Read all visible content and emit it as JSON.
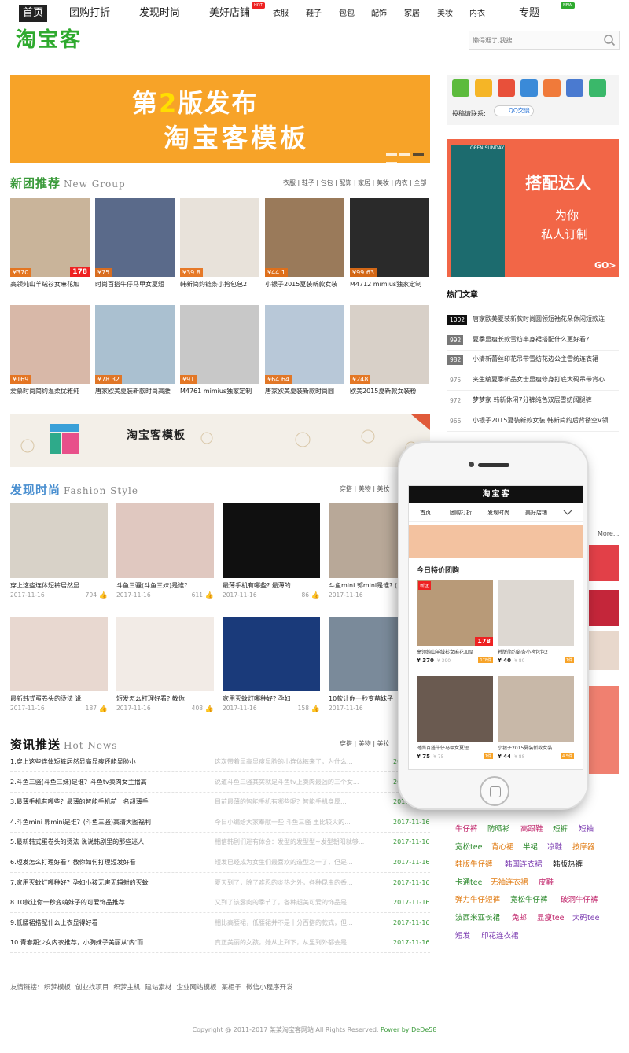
{
  "nav": {
    "main": [
      "首页",
      "团购打折",
      "发现时尚",
      "美好店铺"
    ],
    "categories": [
      "衣服",
      "鞋子",
      "包包",
      "配饰",
      "家居",
      "美妆",
      "内衣"
    ],
    "special": "专题",
    "badges": {
      "hot": "HOT",
      "new": "NEW"
    }
  },
  "logo": "淘宝客",
  "search": {
    "placeholder": "懒得逛了,我搜..."
  },
  "banner": {
    "prefix": "第",
    "version": "2",
    "suffix": "版发布",
    "line2": "淘宝客模板"
  },
  "new_group": {
    "title": "新团推荐",
    "title_en": "New Group",
    "links": "衣服 | 鞋子 | 包包 | 配饰 | 家居 | 美妆 | 内衣 | 全部",
    "products": [
      {
        "price": "¥370",
        "caption": "高领纯山羊绒衫女麻花加",
        "badge": "178"
      },
      {
        "price": "¥75",
        "caption": "时尚百搭牛仔马甲女夏短"
      },
      {
        "price": "¥39.8",
        "caption": "韩新简约链条小挎包包2"
      },
      {
        "price": "¥44.1",
        "caption": "小银子2015夏装新款女装"
      },
      {
        "price": "¥99.63",
        "caption": "M4712 mimius独家定制"
      },
      {
        "price": "¥169",
        "caption": "爱慕时尚简约温柔优雅纯"
      },
      {
        "price": "¥78.32",
        "caption": "唐家欧美夏装新款时尚高腰"
      },
      {
        "price": "¥91",
        "caption": "M4761 mimius独家定制"
      },
      {
        "price": "¥64.64",
        "caption": "唐家欧美夏装新款时尚圆"
      },
      {
        "price": "¥248",
        "caption": "欧美2015夏新款女装粉"
      }
    ]
  },
  "mid_banner": {
    "text": "淘宝客模板"
  },
  "fashion": {
    "title": "发现时尚",
    "title_en": "Fashion Style",
    "links": "穿搭 | 美物 | 美妆",
    "items": [
      {
        "caption": "穿上这些连体短裤居然显",
        "date": "2017-11-16",
        "count": "794"
      },
      {
        "caption": "斗鱼三骚(斗鱼三妹)是谁?",
        "date": "2017-11-16",
        "count": "611"
      },
      {
        "caption": "最薄手机有哪些? 最薄的",
        "date": "2017-11-16",
        "count": "86"
      },
      {
        "caption": "斗鱼mini 郭mini是谁? (",
        "date": "2017-11-16",
        "count": ""
      },
      {
        "caption": "最新韩式蛋卷头的烫法 说",
        "date": "2017-11-16",
        "count": "187"
      },
      {
        "caption": "短发怎么打理好看? 教你",
        "date": "2017-11-16",
        "count": "408"
      },
      {
        "caption": "家用灭蚊灯哪种好? 孕妇",
        "date": "2017-11-16",
        "count": "158"
      },
      {
        "caption": "10款让你一秒变萌妹子",
        "date": "2017-11-16",
        "count": ""
      }
    ]
  },
  "news": {
    "title": "资讯推送",
    "title_en": "Hot News",
    "links": "穿搭 | 美物 | 美妆",
    "items": [
      {
        "title": "1.穿上这些连体短裤居然显高显瘦还能显脸小",
        "desc": "这次带着显高显瘦显脸的小连体裤来了，为什么...",
        "date": "2017-11-16"
      },
      {
        "title": "2.斗鱼三骚(斗鱼三妹)是谁？斗鱼tv卖肉女主播高",
        "desc": "说道斗鱼三骚其实就是斗鱼tv上卖肉最凶的三个女...",
        "date": "2017-11-16"
      },
      {
        "title": "3.最薄手机有哪些？最薄的智能手机前十名超薄手",
        "desc": "目前最薄的智能手机有哪些呢？智能手机身厚...",
        "date": "2017-11-16"
      },
      {
        "title": "4.斗鱼mini 郭mini是谁？(斗鱼三骚)高清大图福利",
        "desc": "今日小编给大家奉献一些 斗鱼三骚 里比较火的...",
        "date": "2017-11-16"
      },
      {
        "title": "5.最新韩式蛋卷头的烫法 说说韩剧里的那些迷人",
        "desc": "相信韩剧们迷有体会：发型的发型型~发型朝阳就够...",
        "date": "2017-11-16"
      },
      {
        "title": "6.短发怎么打理好看？教你如何打理短发好看",
        "desc": "短发已经成为女生们最喜欢的造型之一了，但是...",
        "date": "2017-11-16"
      },
      {
        "title": "7.家用灭蚊灯哪种好？孕妇小孩无害无辐射的灭蚊",
        "desc": "夏天到了，除了难忍的炎热之外，各种昆虫的香...",
        "date": "2017-11-16"
      },
      {
        "title": "8.10款让你一秒变萌妹子的可爱饰品推荐",
        "desc": "又到了该露肉的季节了，各种超美可爱的饰品是...",
        "date": "2017-11-16"
      },
      {
        "title": "9.低腰裙搭配什么上衣显得好看",
        "desc": "相比高腰裙，低腰裙并不是十分百搭的款式，但...",
        "date": "2017-11-16"
      },
      {
        "title": "10.青春期少女内衣推荐，小胸妹子美丽从'内'而",
        "desc": "真正美丽的女孩，她从上到下，从里到外都会是...",
        "date": "2017-11-16"
      }
    ]
  },
  "sidebar": {
    "share_label": "投稿请联系:",
    "qq_label": "QQ交谈",
    "ad": {
      "tag": "OPEN SUNDAY",
      "title": "搭配达人",
      "sub1": "为你",
      "sub2": "私人订制",
      "go": "GO>"
    },
    "hot_title": "热门文章",
    "hot": [
      {
        "num": "1002",
        "text": "唐家欧美夏装新款时尚圆领短袖花朵休闲短款连"
      },
      {
        "num": "992",
        "text": "夏季显瘦长款雪纺半身裙搭配什么更好看?"
      },
      {
        "num": "982",
        "text": "小清新蕾丝印花吊带雪纺花边公主雪纺连衣裙"
      },
      {
        "num": "975",
        "text": "夹生绫夏季新品女士显瘦修身打底大码吊带背心"
      },
      {
        "num": "972",
        "text": "梦梦家 韩新休闲7分裤纯色双层雪纺阔腿裤"
      },
      {
        "num": "966",
        "text": "小银子2015夏装新款女装 韩新简约后背镂空V领"
      }
    ],
    "more": "More...",
    "tags": [
      "牛仔裤",
      "防晒衫",
      "高跟鞋",
      "短裤",
      "短袖",
      "宽松tee",
      "背心裙",
      "半裙",
      "凉鞋",
      "按摩器",
      "韩版牛仔裤",
      "韩国连衣裙",
      "韩版热裤",
      "卡通tee",
      "无袖连衣裙",
      "皮鞋",
      "弹力牛仔短裤",
      "宽松牛仔裤",
      "破洞牛仔裤",
      "波西米亚长裙",
      "兔邮",
      "显瘦tee",
      "大码tee",
      "短发",
      "印花连衣裙"
    ]
  },
  "phone": {
    "brand": "淘宝客",
    "nav": [
      "首页",
      "团购打折",
      "发现时尚",
      "美好店铺"
    ],
    "section": "今日特价团购",
    "new_tag": "新团",
    "items": [
      {
        "caption": "高领纯山羊绒衫女麻花加厚",
        "price": "¥ 370",
        "old": "¥ 390",
        "sold": "178件",
        "badge": "178"
      },
      {
        "caption": "韩版简约链条小挎包包2",
        "price": "¥ 40",
        "old": "¥ 80",
        "sold": "1件"
      },
      {
        "caption": "时尚百搭牛仔马甲女夏短",
        "price": "¥ 75",
        "old": "¥ 75",
        "sold": "1件"
      },
      {
        "caption": "小银子2015夏装新款女装",
        "price": "¥ 44",
        "old": "¥ 88",
        "sold": "4.5件"
      }
    ]
  },
  "footer": {
    "links_label": "友情链接:",
    "links": [
      "织梦模板",
      "创业找项目",
      "织梦主机",
      "建站素材",
      "企业网站模板",
      "某柜子",
      "微信小程序开发"
    ],
    "copyright": "Copyright @ 2011-2017 某某淘宝客网站 All Rights Reserved.",
    "powered": "Power by DeDe58"
  },
  "colors": {
    "accent_green": "#2eaa2e",
    "banner_orange": "#f7a328",
    "price_orange": "#e66e14",
    "hot_dark": "#111111"
  }
}
